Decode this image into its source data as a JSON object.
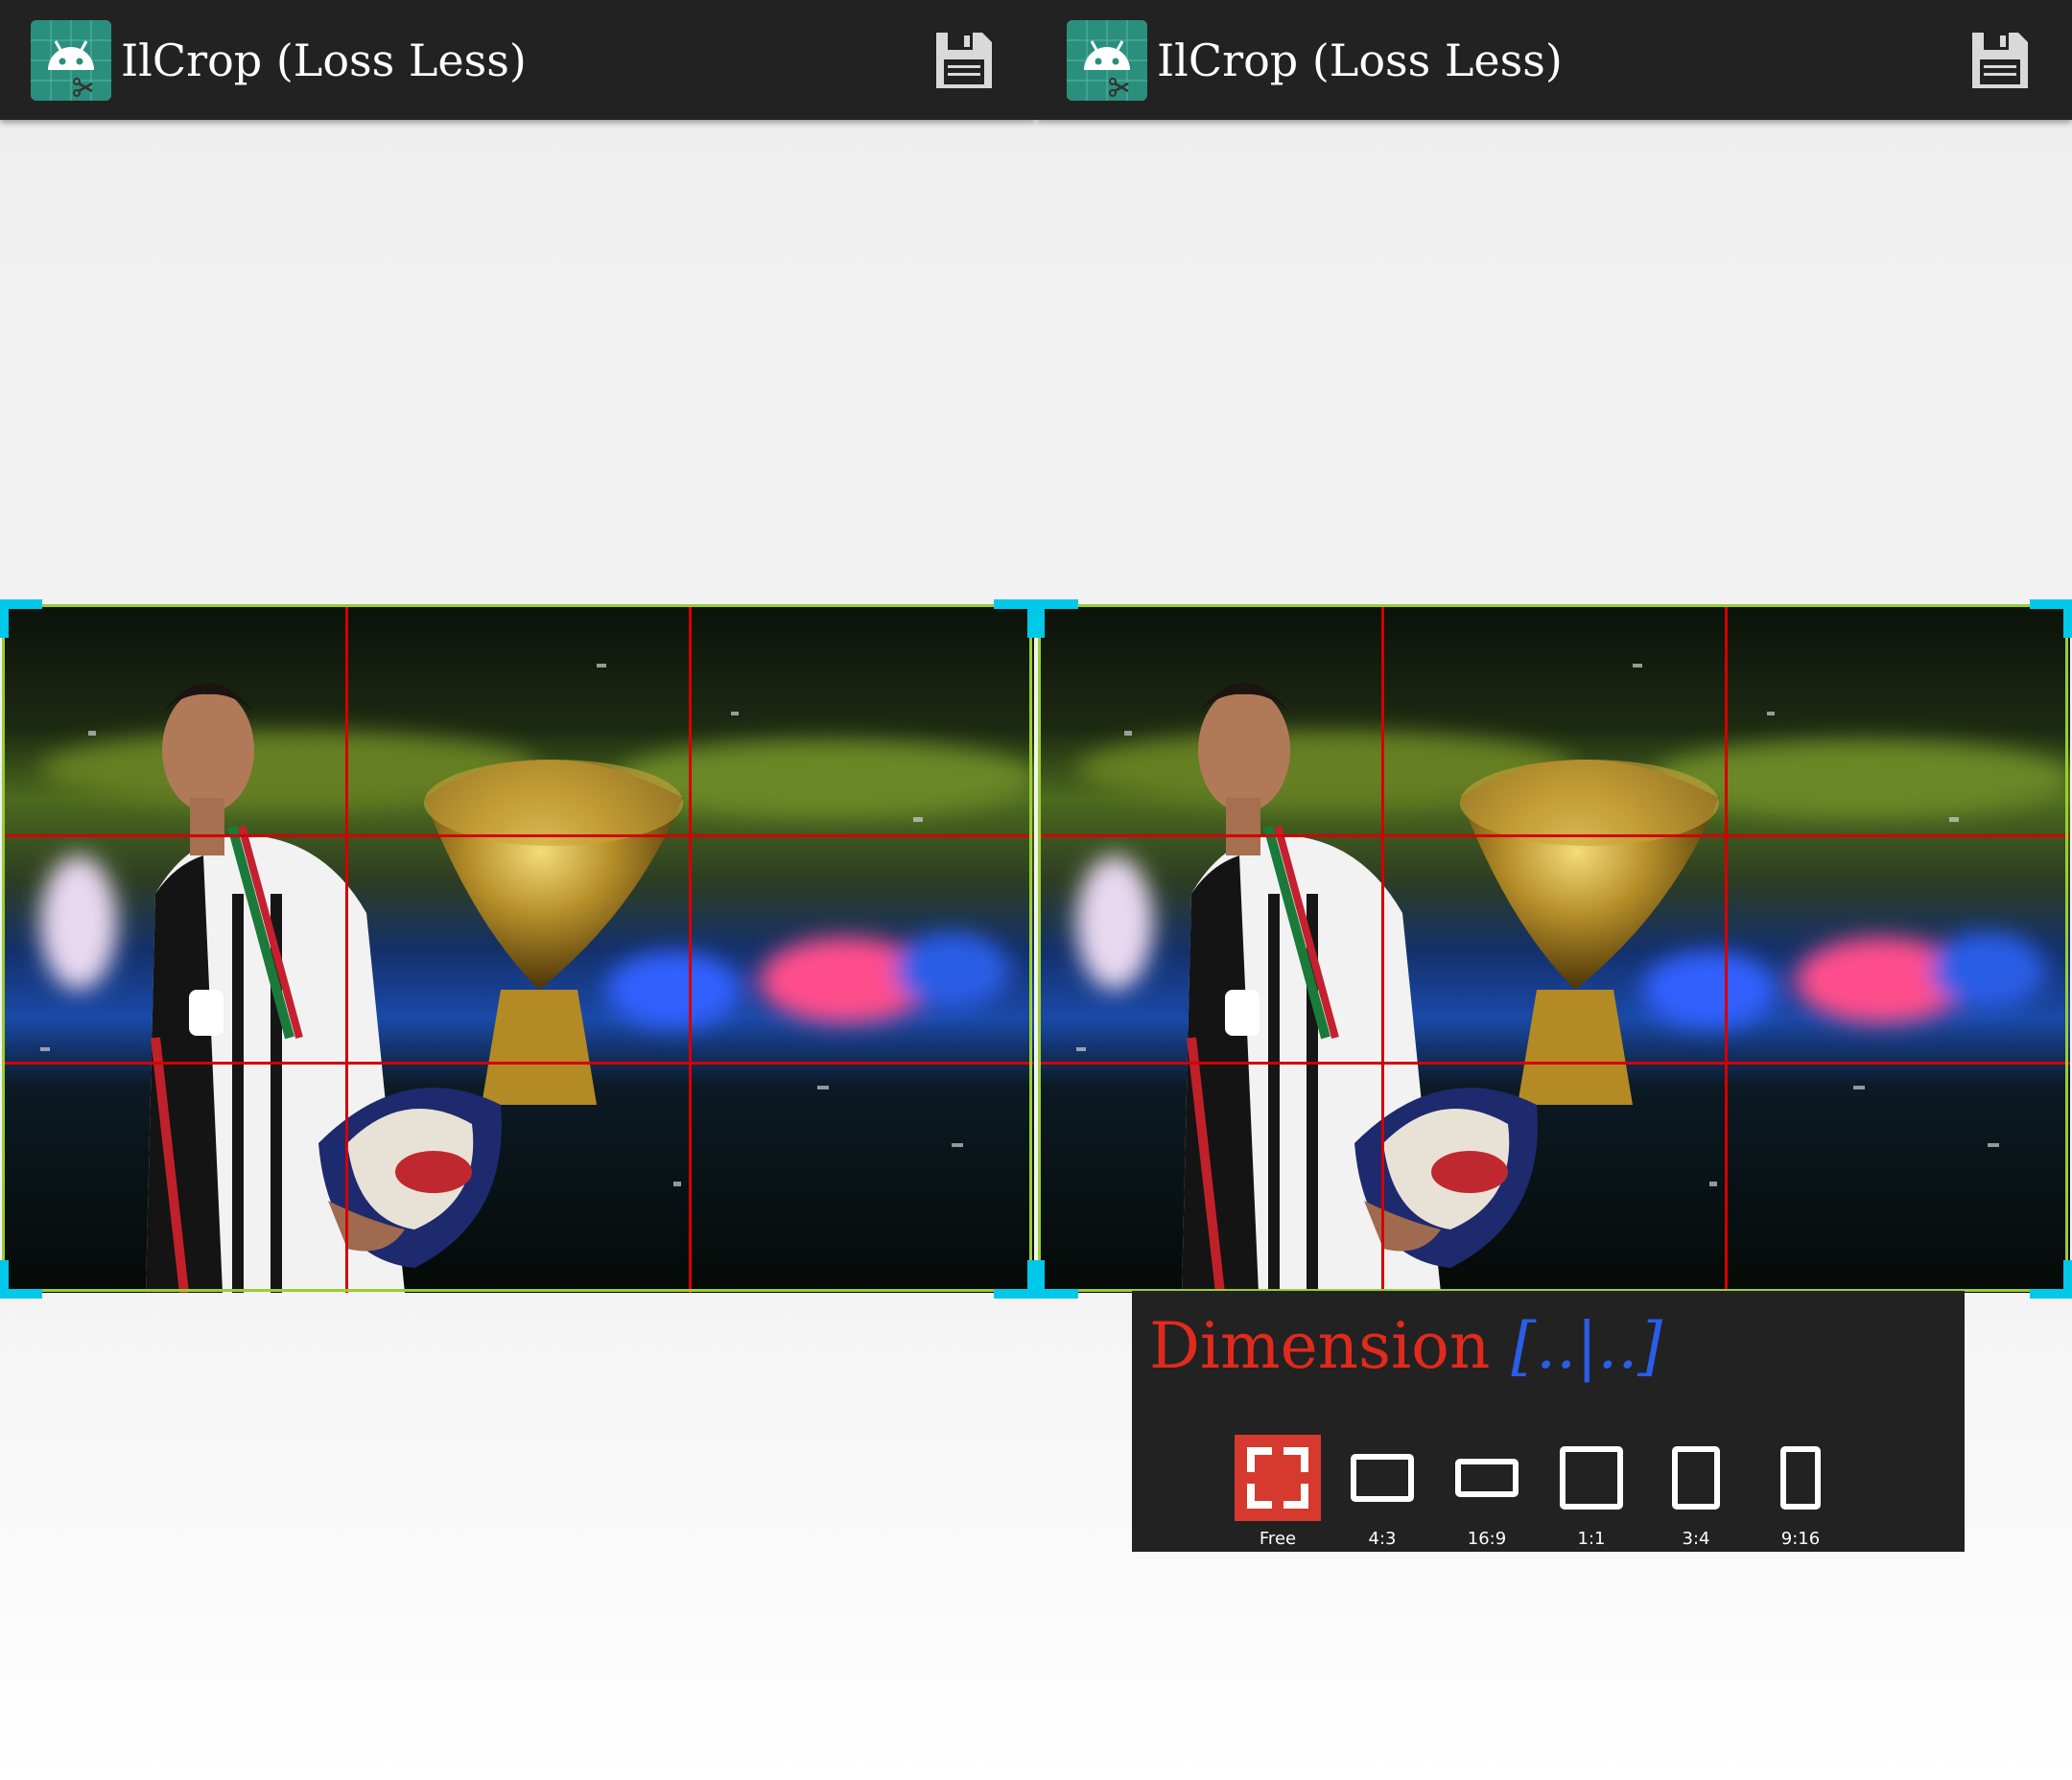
{
  "app": {
    "title": "IlCrop (Loss Less)"
  },
  "dimension": {
    "label": "Dimension",
    "value": "[..|..]"
  },
  "aspect_ratios": [
    {
      "label": "Free",
      "selected": true
    },
    {
      "label": "4:3",
      "selected": false
    },
    {
      "label": "16:9",
      "selected": false
    },
    {
      "label": "1:1",
      "selected": false
    },
    {
      "label": "3:4",
      "selected": false
    },
    {
      "label": "9:16",
      "selected": false
    }
  ],
  "colors": {
    "toolbar": "#222222",
    "grid_line": "#d40000",
    "crop_border": "#9acd32",
    "handle": "#00c8e8",
    "selected_ratio": "#d63a2e",
    "dimension_text": "#e22a1c",
    "dimension_value": "#2a5de8"
  }
}
